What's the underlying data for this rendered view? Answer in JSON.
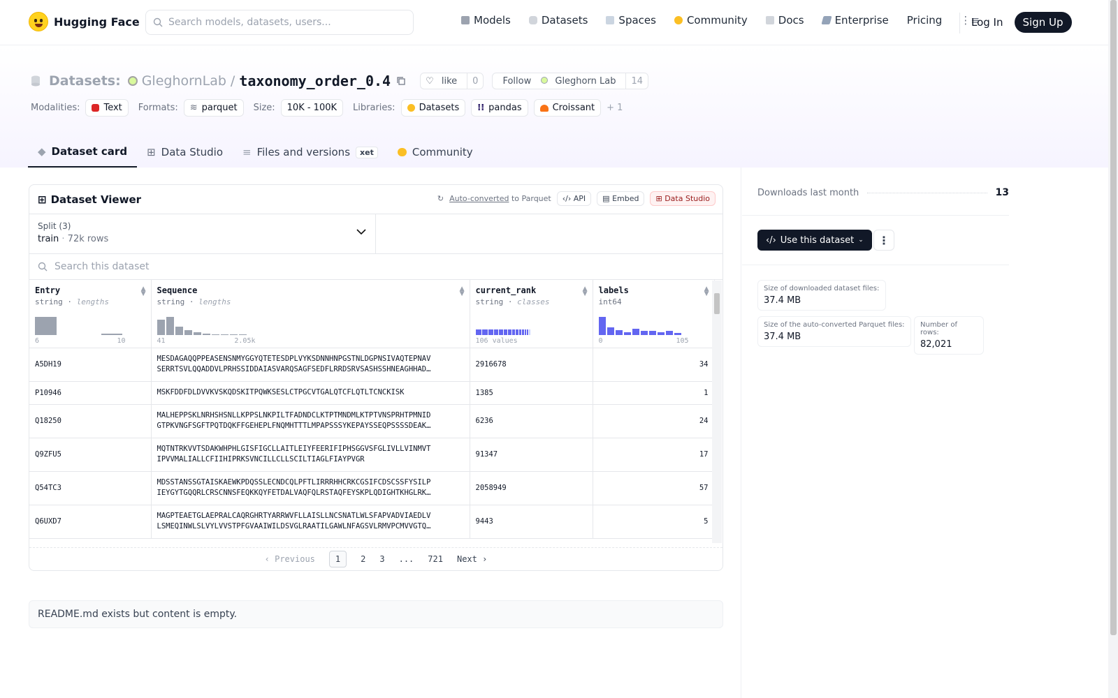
{
  "nav": {
    "brand": "Hugging Face",
    "search_placeholder": "Search models, datasets, users...",
    "items": [
      "Models",
      "Datasets",
      "Spaces",
      "Community",
      "Docs",
      "Enterprise",
      "Pricing"
    ],
    "login": "Log In",
    "signup": "Sign Up"
  },
  "header": {
    "section": "Datasets:",
    "org": "GleghornLab",
    "sep": "/",
    "name": "taxonomy_order_0.4",
    "like_label": "like",
    "like_count": "0",
    "follow_label": "Follow",
    "follow_org": "Gleghorn Lab",
    "follow_count": "14",
    "modalities_label": "Modalities:",
    "modality": "Text",
    "formats_label": "Formats:",
    "format": "parquet",
    "size_label": "Size:",
    "size": "10K - 100K",
    "libraries_label": "Libraries:",
    "libraries": [
      "Datasets",
      "pandas",
      "Croissant"
    ],
    "more_libs": "+ 1"
  },
  "tabs": [
    "Dataset card",
    "Data Studio",
    "Files and versions",
    "Community"
  ],
  "xet_badge": "xet",
  "viewer": {
    "title": "Dataset Viewer",
    "autoconv": "Auto-converted",
    "to_parquet": "to Parquet",
    "api": "API",
    "embed": "Embed",
    "studio": "Data Studio",
    "split_label": "Split (3)",
    "split_value": "train",
    "split_rows": "72k rows",
    "search_placeholder": "Search this dataset",
    "columns": [
      {
        "name": "Entry",
        "type": "string",
        "kind": "lengths",
        "min": "6",
        "max": "10"
      },
      {
        "name": "Sequence",
        "type": "string",
        "kind": "lengths",
        "min": "41",
        "max": "2.05k"
      },
      {
        "name": "current_rank",
        "type": "string",
        "kind": "classes",
        "min": "106 values",
        "max": ""
      },
      {
        "name": "labels",
        "type": "int64",
        "kind": "",
        "min": "0",
        "max": "105"
      }
    ],
    "rows": [
      {
        "entry": "A5DH19",
        "seq1": "MESDAGAQQPPEASENSNMYGGYQTETESDPLVYKSDNNHNPGSTNLDGPNSIVAQTEPNAV",
        "seq2": "SERRTSVLQQADDVLPRHSSIDDAIASVARQSAGFSEDFLRRDSRVSASHSSHNEAGHHAD…",
        "rank": "2916678",
        "label": "34"
      },
      {
        "entry": "P10946",
        "seq1": "MSKFDDFDLDVVKVSKQDSKITPQWKSESLCTPGCVTGALQTCFLQTLTCNCKISK",
        "seq2": "",
        "rank": "1385",
        "label": "1"
      },
      {
        "entry": "Q18250",
        "seq1": "MALHEPPSKLNRHSHSNLLKPPSLNKPILTFADNDCLKTPTMNDMLKTPTVNSPRHTPMNID",
        "seq2": "GTPKVNGFSGFTPQTDQKFFGEHEPLFNQMHTTTLMPAPSSSYKEPAYSSEQPSSSSDEAK…",
        "rank": "6236",
        "label": "24"
      },
      {
        "entry": "Q9ZFU5",
        "seq1": "MQTNTRKVVTSDAKWHPHLGISFIGCLLAITLEIYFEERIFIPHSGGVSFGLIVLLVINMVT",
        "seq2": "IPVVMALIALLCFIIHIPRKSVNCILLCLLSCILTIAGLFIAYPVGR",
        "rank": "91347",
        "label": "17"
      },
      {
        "entry": "Q54TC3",
        "seq1": "MDSSTANSSGTAISKAEWKPDQSSLECNDCQLPFTLIRRRHHCRKCGSIFCDSCSSFYSILP",
        "seq2": "IEYGYTGQQRLCRSCNNSFEQKKQYFETDALVAQFQLRSTAQFEYSKPLQDIGHTKHGLRK…",
        "rank": "2058949",
        "label": "57"
      },
      {
        "entry": "Q6UXD7",
        "seq1": "MAGPTEAETGLAEPRALCAQRGHRTYARRWVFLLAISLLNCSNATLWLSFAPVADVIAEDLV",
        "seq2": "LSMEQINWLSLVYLVVSTPFGVAAIWILDSVGLRAATILGAWLNFAGSVLRMVPCMVVGTQ…",
        "rank": "9443",
        "label": "5"
      }
    ],
    "pager": {
      "prev": "Previous",
      "pages": [
        "1",
        "2",
        "3",
        "...",
        "721"
      ],
      "next": "Next"
    }
  },
  "readme": "README.md exists but content is empty.",
  "side": {
    "downloads_label": "Downloads last month",
    "downloads": "13",
    "use_btn": "Use this dataset",
    "size_dl_label": "Size of downloaded dataset files:",
    "size_dl": "37.4 MB",
    "size_pq_label": "Size of the auto-converted Parquet files:",
    "size_pq": "37.4 MB",
    "rows_label": "Number of rows:",
    "rows": "82,021"
  },
  "colors": {
    "accent": "#111827",
    "brand": "#ffd21e",
    "hist_blue": "#6366f1"
  }
}
